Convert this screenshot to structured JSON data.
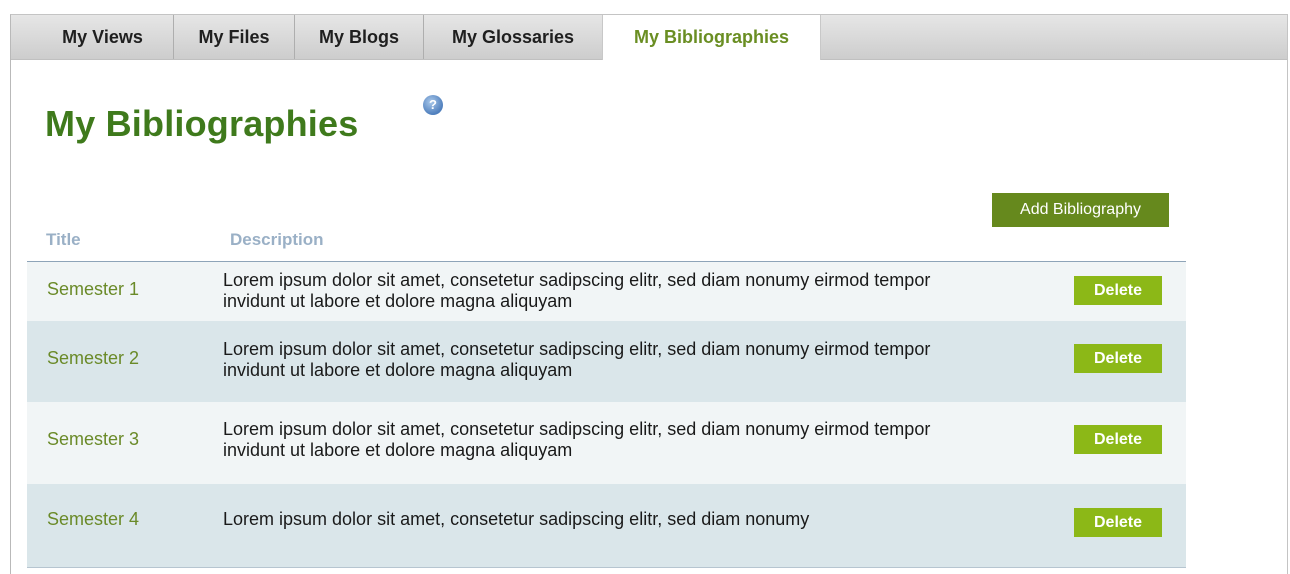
{
  "tabs": [
    {
      "label": "My Views"
    },
    {
      "label": "My Files"
    },
    {
      "label": "My Blogs"
    },
    {
      "label": "My Glossaries"
    },
    {
      "label": "My Bibliographies",
      "active": true
    }
  ],
  "page": {
    "title": "My Bibliographies",
    "help_icon": "help-icon",
    "help_glyph": "?"
  },
  "toolbar": {
    "add_label": "Add Bibliography"
  },
  "table": {
    "headers": {
      "title": "Title",
      "description": "Description"
    },
    "rows": [
      {
        "title": "Semester 1",
        "description": "Lorem ipsum dolor sit amet, consetetur sadipscing elitr, sed diam nonumy eirmod tempor invidunt ut labore et dolore magna aliquyam",
        "delete_label": "Delete"
      },
      {
        "title": "Semester 2",
        "description": "Lorem ipsum dolor sit amet, consetetur sadipscing elitr, sed diam nonumy eirmod tempor invidunt ut labore et dolore magna aliquyam",
        "delete_label": "Delete"
      },
      {
        "title": "Semester 3",
        "description": "Lorem ipsum dolor sit amet, consetetur sadipscing elitr, sed diam nonumy eirmod tempor invidunt ut labore et dolore magna aliquyam",
        "delete_label": "Delete"
      },
      {
        "title": "Semester 4",
        "description": "Lorem ipsum dolor sit amet, consetetur sadipscing elitr, sed diam nonumy",
        "delete_label": "Delete"
      }
    ]
  },
  "colors": {
    "accent_green": "#3f7a1c",
    "tab_active_text": "#6a8e23",
    "button_dark_green": "#66891d",
    "button_light_green": "#8cb817",
    "header_text": "#9ab0c6",
    "row_odd": "#f1f5f6",
    "row_even": "#dae6ea"
  }
}
